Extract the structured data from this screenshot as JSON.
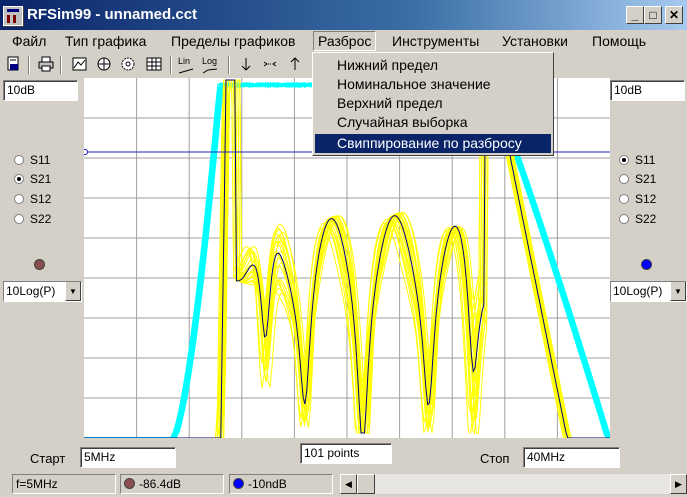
{
  "window": {
    "title": "RFSim99 - unnamed.cct",
    "min": "_",
    "max": "□",
    "close": "✕"
  },
  "menu": [
    "Файл",
    "Тип графика",
    "Пределы графиков",
    "Разброс",
    "Инструменты",
    "Установки",
    "Помощь"
  ],
  "toolbar_text": {
    "lin": "Lin",
    "log": "Log"
  },
  "dropdown": {
    "items": [
      "Нижний предел",
      "Номинальное значение",
      "Верхний предел",
      "Случайная выборка",
      "Свиппирование по разбросу"
    ],
    "highlighted": 4
  },
  "left_panel": {
    "scale": "10dB",
    "params": [
      "S11",
      "S21",
      "S12",
      "S22"
    ],
    "selected": "S21",
    "marker_color": "#8b4e4e",
    "mode": "10Log(P)"
  },
  "right_panel": {
    "scale": "10dB",
    "params": [
      "S11",
      "S21",
      "S12",
      "S22"
    ],
    "selected": "S11",
    "marker_color": "#0000ff",
    "mode": "10Log(P)"
  },
  "bottom": {
    "start_label": "Старт",
    "start_value": "5MHz",
    "points": "101 points",
    "stop_label": "Стоп",
    "stop_value": "40MHz"
  },
  "status": {
    "freq": "f=5MHz",
    "left_value": "-86.4dB",
    "right_value": "-10ndB"
  },
  "colors": {
    "yellow_trace": "#ffff00",
    "cyan_trace": "#00ffff",
    "nominal": "#000080",
    "grid": "#a0a0a0"
  }
}
